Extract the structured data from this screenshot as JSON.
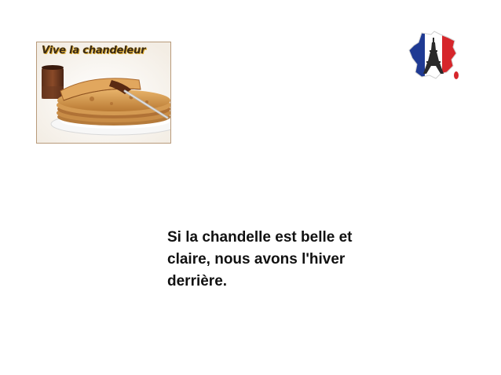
{
  "slide": {
    "image_caption": "Vive la chandeleur",
    "proverb": "Si la chandelle est belle et\nclaire, nous avons l'hiver\nderrière."
  },
  "icons": {
    "photo": "crepe-plate-photo",
    "flag": "france-flag-map-eiffel-icon"
  },
  "colors": {
    "background": "#ffffff",
    "text": "#111111",
    "flag_blue": "#1f3a93",
    "flag_white": "#ffffff",
    "flag_red": "#d6262b"
  }
}
